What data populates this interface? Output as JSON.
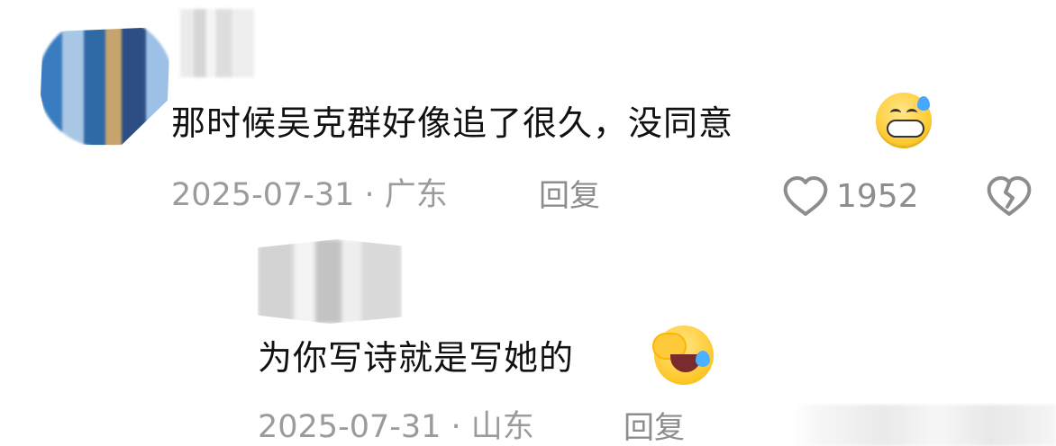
{
  "comments": [
    {
      "text": "那时候吴克群好像追了很久，没同意",
      "date_location": "2025-07-31 · 广东",
      "reply_label": "回复",
      "like_count": "1952",
      "emoji_icon": "grimacing-sweat-icon"
    },
    {
      "text": "为你写诗就是写她的",
      "date_location": "2025-07-31 · 山东",
      "reply_label": "回复",
      "emoji_icon": "facepalm-laughing-icon"
    }
  ],
  "icons": {
    "like": "heart-icon",
    "dislike": "broken-heart-icon"
  }
}
